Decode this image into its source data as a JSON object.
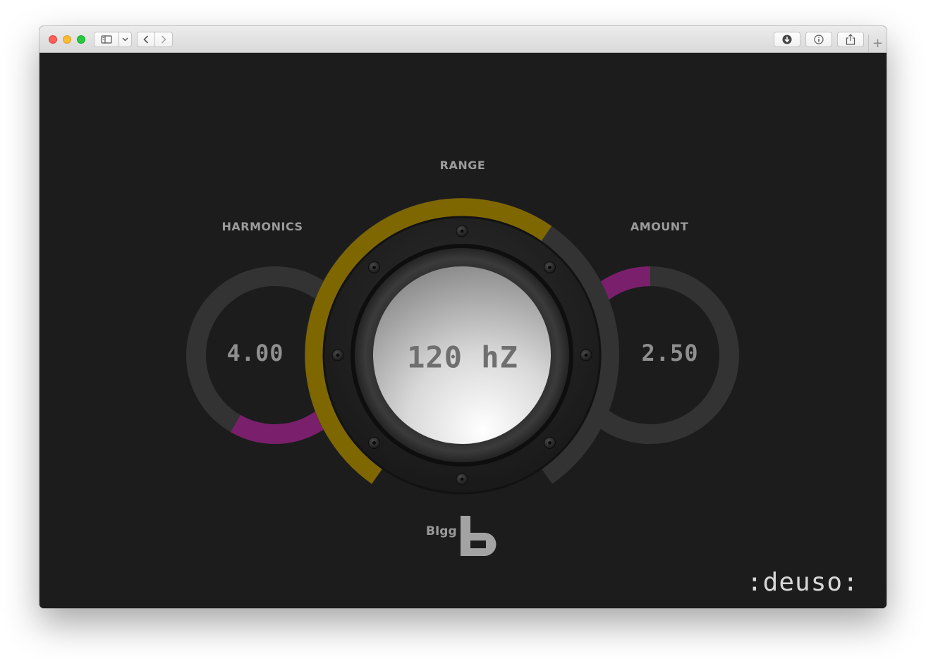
{
  "window": {
    "toolbar_icons": [
      "sidebar-icon",
      "chevron-down-icon",
      "back-icon",
      "forward-icon",
      "download-icon",
      "info-icon",
      "share-icon",
      "plus-icon"
    ],
    "new_tab_label": "+"
  },
  "plugin": {
    "range": {
      "label": "RANGE",
      "value_text": "120 hZ",
      "fill_fraction": 0.62
    },
    "harmonics": {
      "label": "HARMONICS",
      "value_text": "4.00",
      "fill_fraction": 0.25
    },
    "amount": {
      "label": "AMOUNT",
      "value_text": "2.50",
      "fill_fraction": 0.2
    },
    "brand": {
      "name": "BIgg",
      "logo_letter": "b"
    },
    "maker": ":deuso:"
  },
  "colors": {
    "background": "#1c1c1c",
    "track": "#333333",
    "range_arc": "#7f6700",
    "mod_arc": "#7a1f6b",
    "label": "#9b9b9b"
  }
}
